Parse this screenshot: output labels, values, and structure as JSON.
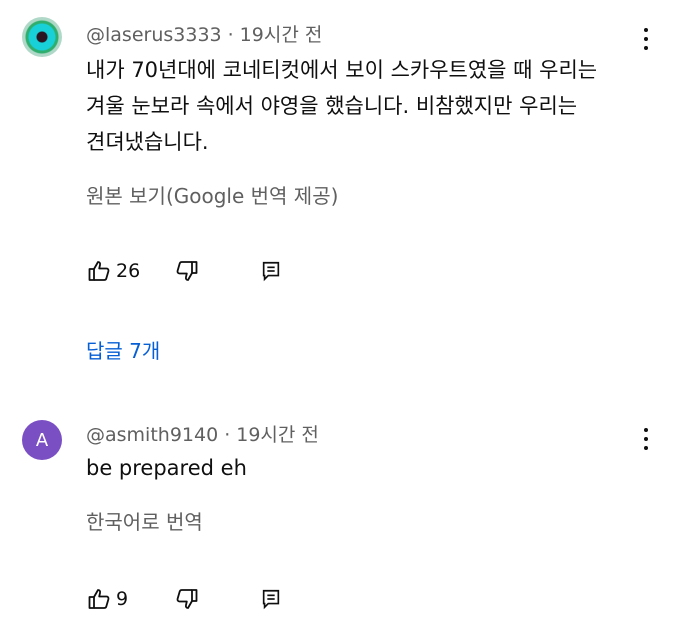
{
  "comments": [
    {
      "author": "@laserus3333",
      "time": "19시간 전",
      "text_lines": [
        "내가 70년대에 코네티컷에서 보이 스카우트였을 때 우리는",
        "겨울 눈보라 속에서 야영을 했습니다. 비참했지만 우리는",
        "견뎌냈습니다."
      ],
      "translate_label": "원본 보기(Google 번역 제공)",
      "likes": "26",
      "replies_label": "답글 7개",
      "avatar": {
        "type": "image"
      }
    },
    {
      "author": "@asmith9140",
      "time": "19시간 전",
      "text_lines": [
        "be prepared eh"
      ],
      "translate_label": "한국어로 번역",
      "likes": "9",
      "avatar": {
        "type": "letter",
        "letter": "A",
        "color": "#7b4fc4"
      }
    }
  ],
  "separator": "·",
  "icons": {
    "like": "thumbs-up-icon",
    "dislike": "thumbs-down-icon",
    "reply": "reply-icon",
    "more": "more-vertical-icon"
  }
}
